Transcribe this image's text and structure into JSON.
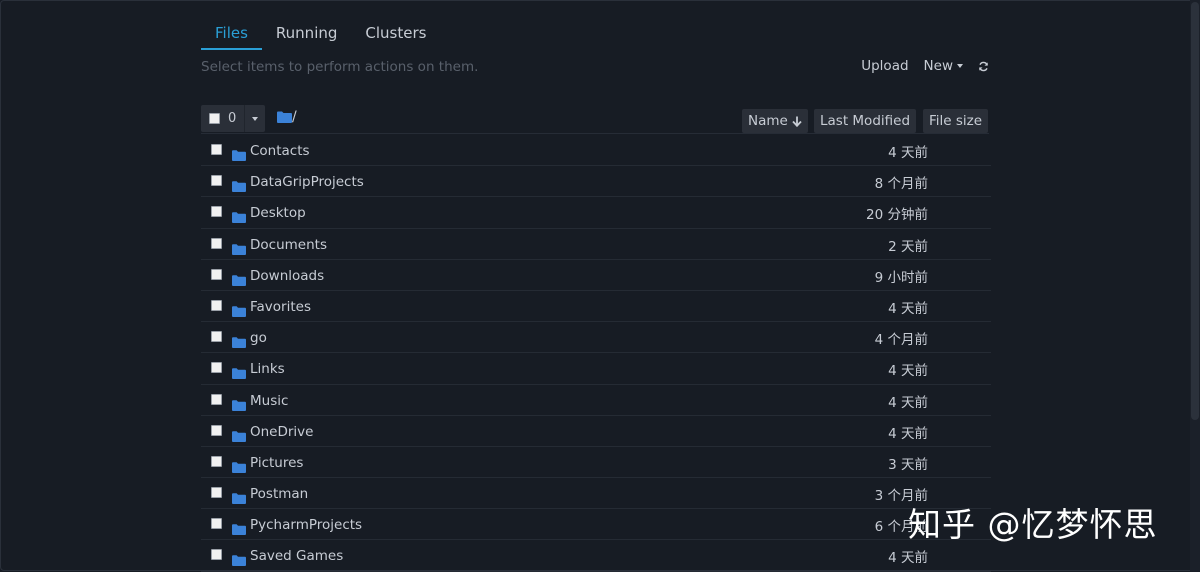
{
  "tabs": [
    {
      "label": "Files",
      "active": true
    },
    {
      "label": "Running",
      "active": false
    },
    {
      "label": "Clusters",
      "active": false
    }
  ],
  "hint": "Select items to perform actions on them.",
  "actions": {
    "upload": "Upload",
    "new": "New"
  },
  "toolbar": {
    "selected_count": "0",
    "breadcrumb": "/",
    "sort_name": "Name",
    "sort_modified": "Last Modified",
    "sort_size": "File size"
  },
  "files": [
    {
      "name": "Contacts",
      "modified": "4 天前"
    },
    {
      "name": "DataGripProjects",
      "modified": "8 个月前"
    },
    {
      "name": "Desktop",
      "modified": "20 分钟前"
    },
    {
      "name": "Documents",
      "modified": "2 天前"
    },
    {
      "name": "Downloads",
      "modified": "9 小时前"
    },
    {
      "name": "Favorites",
      "modified": "4 天前"
    },
    {
      "name": "go",
      "modified": "4 个月前"
    },
    {
      "name": "Links",
      "modified": "4 天前"
    },
    {
      "name": "Music",
      "modified": "4 天前"
    },
    {
      "name": "OneDrive",
      "modified": "4 天前"
    },
    {
      "name": "Pictures",
      "modified": "3 天前"
    },
    {
      "name": "Postman",
      "modified": "3 个月前"
    },
    {
      "name": "PycharmProjects",
      "modified": "6 个月前"
    },
    {
      "name": "Saved Games",
      "modified": "4 天前"
    }
  ],
  "watermark": "知乎 @忆梦怀思",
  "colors": {
    "accent": "#2a9fd6",
    "folder": "#3b82d8",
    "background": "#171c24"
  }
}
